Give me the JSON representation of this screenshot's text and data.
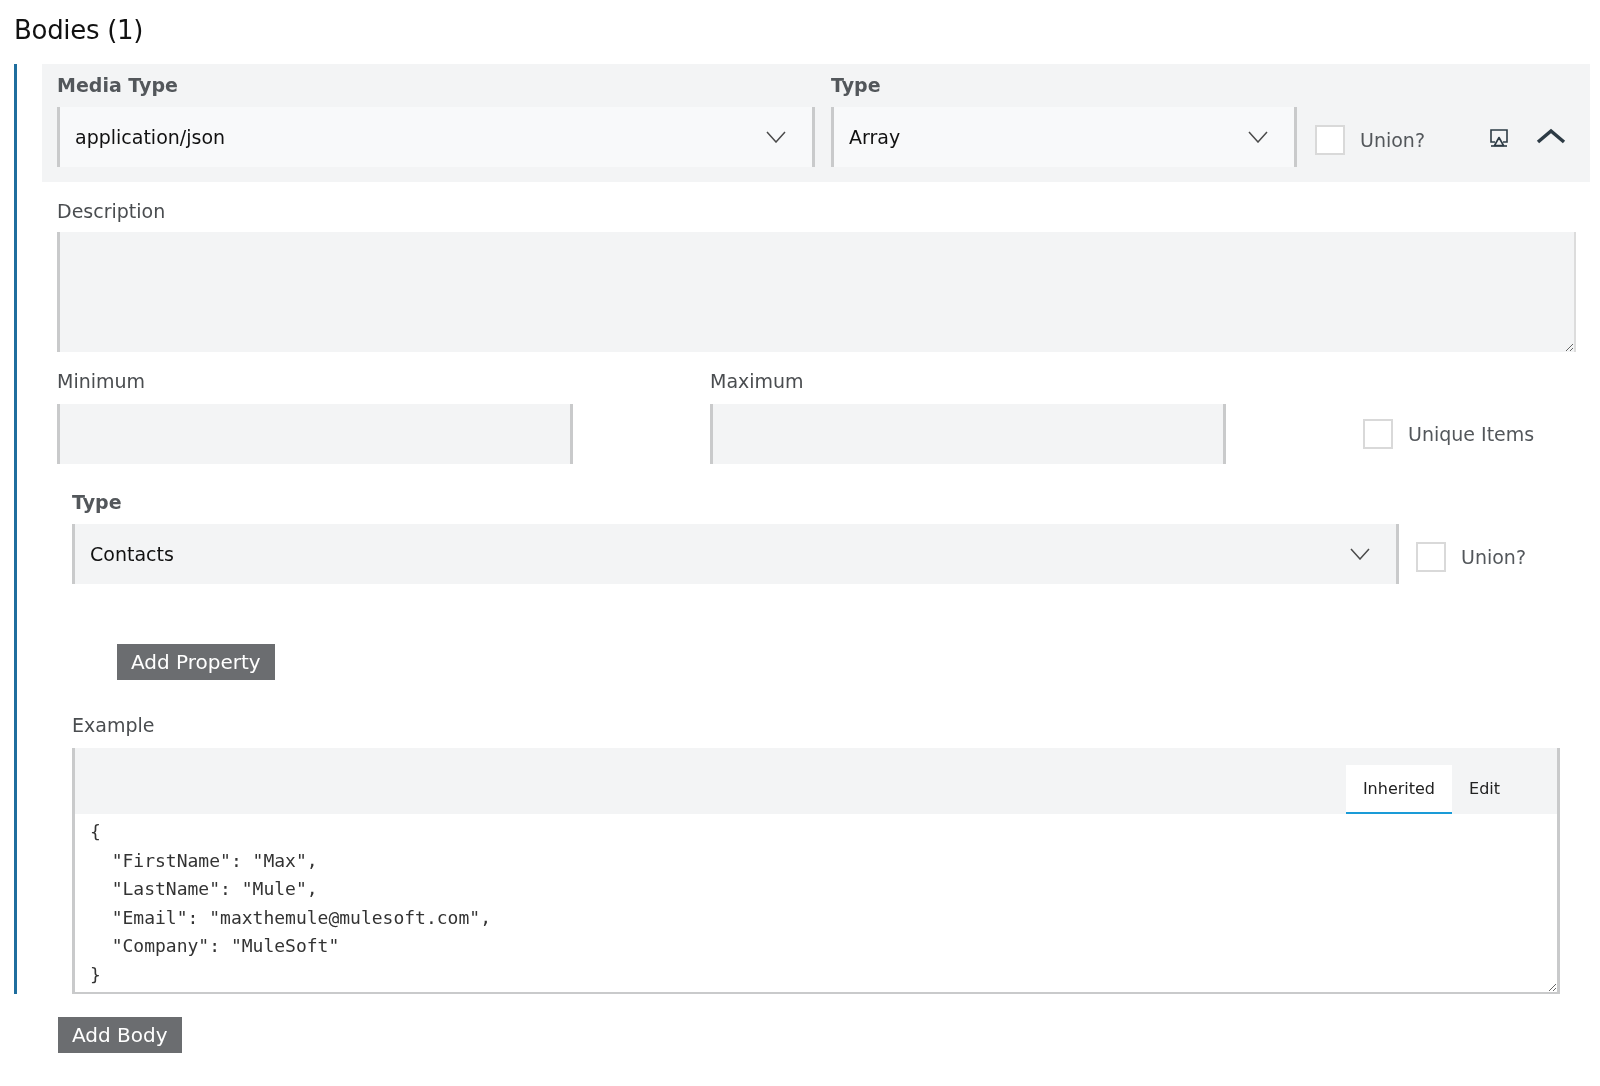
{
  "section": {
    "title": "Bodies (1)"
  },
  "body": {
    "media_type": {
      "label": "Media Type",
      "value": "application/json"
    },
    "type": {
      "label": "Type",
      "value": "Array"
    },
    "union": {
      "label": "Union?",
      "checked": false
    },
    "expanded": true,
    "description": {
      "label": "Description"
    },
    "minimum": {
      "label": "Minimum"
    },
    "maximum": {
      "label": "Maximum"
    },
    "unique_items": {
      "label": "Unique Items",
      "checked": false
    },
    "items": {
      "type": {
        "label": "Type",
        "value": "Contacts"
      },
      "union": {
        "label": "Union?",
        "checked": false
      }
    },
    "add_property_button": "Add Property",
    "example": {
      "label": "Example",
      "tabs": [
        {
          "label": "Inherited",
          "selected": true
        },
        {
          "label": "Edit",
          "selected": false
        }
      ],
      "code": "{\n  \"FirstName\": \"Max\",\n  \"LastName\": \"Mule\",\n  \"Email\": \"maxthemule@mulesoft.com\",\n  \"Company\": \"MuleSoft\"\n}"
    }
  },
  "add_body_button": "Add Body"
}
